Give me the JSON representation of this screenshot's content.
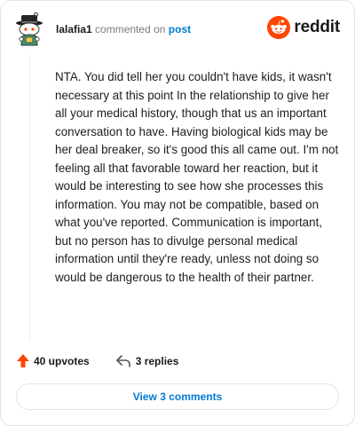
{
  "header": {
    "username": "lalafia1",
    "commented_on": "commented on",
    "post_link": "post",
    "brand": "reddit"
  },
  "comment": {
    "text": "NTA. You did tell her you couldn't have kids, it wasn't necessary at this point In the relationship to give her all your medical history, though that us an important conversation to have. Having biological kids may be her deal breaker, so it's good this all came out. I'm not feeling all that favorable toward her reaction, but it would be interesting to see how she processes this information. You may not be compatible, based on what you've reported. Communication is important, but no person has to divulge personal medical information until they're ready, unless not doing so would be dangerous to the health of their partner."
  },
  "actions": {
    "upvotes": "40 upvotes",
    "replies": "3 replies"
  },
  "footer": {
    "view_comments": "View 3 comments"
  },
  "colors": {
    "brand_orange": "#ff4500",
    "link_blue": "#0079d3"
  },
  "icons": {
    "avatar": "snoo-avatar-with-hat",
    "logo": "reddit-snoo-icon",
    "upvote": "upvote-arrow-icon",
    "reply": "reply-arrow-icon"
  }
}
